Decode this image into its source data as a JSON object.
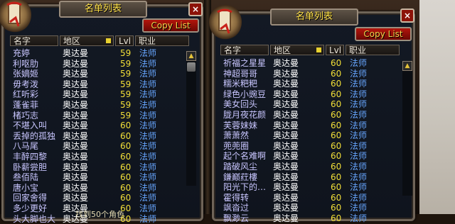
{
  "left_panel": {
    "title": "名单列表",
    "close_label": "×",
    "copy_label": "Copy List",
    "headers": {
      "name": "名字",
      "zone": "地区",
      "level": "Lvl",
      "class": "职业"
    },
    "rows": [
      {
        "name": "充婷",
        "zone": "奥达曼",
        "level": "59",
        "class": "法师"
      },
      {
        "name": "利呕肋",
        "zone": "奥达曼",
        "level": "59",
        "class": "法师"
      },
      {
        "name": "张嫡姬",
        "zone": "奥达曼",
        "level": "59",
        "class": "法师"
      },
      {
        "name": "毋考泼",
        "zone": "奥达曼",
        "level": "59",
        "class": "法师"
      },
      {
        "name": "红听彩",
        "zone": "奥达曼",
        "level": "59",
        "class": "法师"
      },
      {
        "name": "蓬雀菲",
        "zone": "奥达曼",
        "level": "59",
        "class": "法师"
      },
      {
        "name": "楮巧志",
        "zone": "奥达曼",
        "level": "59",
        "class": "法师"
      },
      {
        "name": "不堪入叫",
        "zone": "奥达曼",
        "level": "60",
        "class": "法师"
      },
      {
        "name": "丢掉的孤独",
        "zone": "奥达曼",
        "level": "60",
        "class": "法师"
      },
      {
        "name": "八马尾",
        "zone": "奥达曼",
        "level": "60",
        "class": "法师"
      },
      {
        "name": "丰醉四黎",
        "zone": "奥达曼",
        "level": "60",
        "class": "法师"
      },
      {
        "name": "卧薪尝胆",
        "zone": "奥达曼",
        "level": "60",
        "class": "法师"
      },
      {
        "name": "叁佰陆",
        "zone": "奥达曼",
        "level": "60",
        "class": "法师"
      },
      {
        "name": "唐小宝",
        "zone": "奥达曼",
        "level": "60",
        "class": "法师"
      },
      {
        "name": "回家舍得",
        "zone": "奥达曼",
        "level": "60",
        "class": "法师"
      },
      {
        "name": "多少更好",
        "zone": "奥达曼",
        "level": "60",
        "class": "法师"
      },
      {
        "name": "头大脚也大",
        "zone": "奥达曼",
        "level": "60",
        "class": "法师"
      }
    ],
    "footer": "找到50个角色"
  },
  "right_panel": {
    "title": "名单列表",
    "close_label": "×",
    "copy_label": "Copy List",
    "headers": {
      "name": "名字",
      "zone": "地区",
      "level": "Lvl",
      "class": "职业"
    },
    "rows": [
      {
        "name": "祈福之星星",
        "zone": "奥达曼",
        "level": "60",
        "class": "法师"
      },
      {
        "name": "神超哥哥",
        "zone": "奥达曼",
        "level": "60",
        "class": "法师"
      },
      {
        "name": "糯米粑粑",
        "zone": "奥达曼",
        "level": "60",
        "class": "法师"
      },
      {
        "name": "绿色小豌豆",
        "zone": "奥达曼",
        "level": "60",
        "class": "法师"
      },
      {
        "name": "美女回头",
        "zone": "奥达曼",
        "level": "60",
        "class": "法师"
      },
      {
        "name": "胧月夜花颜",
        "zone": "奥达曼",
        "level": "60",
        "class": "法师"
      },
      {
        "name": "芙蓉妹妹",
        "zone": "奥达曼",
        "level": "60",
        "class": "法师"
      },
      {
        "name": "萧萧然",
        "zone": "奥达曼",
        "level": "60",
        "class": "法师"
      },
      {
        "name": "蔸蔸圈",
        "zone": "奥达曼",
        "level": "60",
        "class": "法师"
      },
      {
        "name": "起个名难啊",
        "zone": "奥达曼",
        "level": "60",
        "class": "法师"
      },
      {
        "name": "踏破风尘",
        "zone": "奥达曼",
        "level": "60",
        "class": "法师"
      },
      {
        "name": "鎌巅荭樓",
        "zone": "奥达曼",
        "level": "60",
        "class": "法师"
      },
      {
        "name": "阳光下的…",
        "zone": "奥达曼",
        "level": "60",
        "class": "法师"
      },
      {
        "name": "霍得转",
        "zone": "奥达曼",
        "level": "60",
        "class": "法师"
      },
      {
        "name": "飒沓过",
        "zone": "奥达曼",
        "level": "60",
        "class": "法师"
      },
      {
        "name": "飘渺云",
        "zone": "奥达曼",
        "level": "60",
        "class": "法师"
      }
    ]
  },
  "scroll_up_icon": "▲"
}
